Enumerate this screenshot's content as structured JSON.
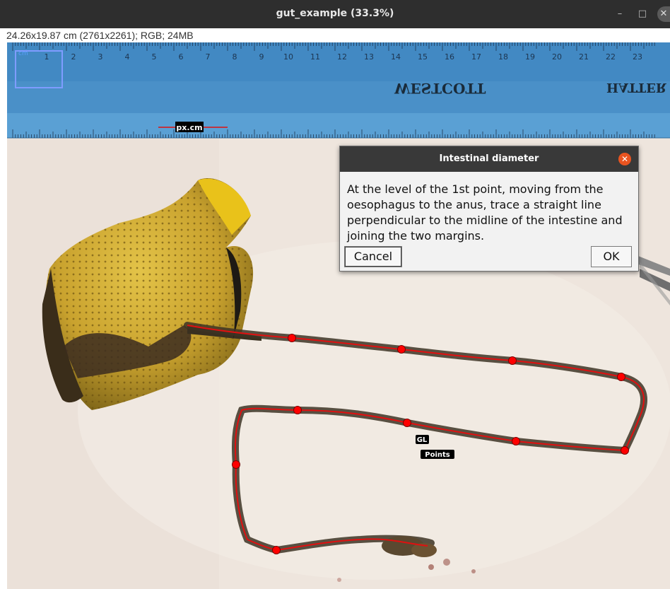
{
  "window": {
    "title": "gut_example (33.3%)",
    "minimize_glyph": "–",
    "maximize_glyph": "□",
    "close_glyph": "✕"
  },
  "image_info": "24.26x19.87 cm (2761x2261); RGB; 24MB",
  "overlay": {
    "scale_label": "px.cm",
    "gl_label": "GL",
    "points_label": "Points",
    "ruler_brand": "WESTCOTT",
    "ruler_numbers": [
      "1",
      "2",
      "3",
      "4",
      "5",
      "6",
      "7",
      "8",
      "9",
      "10",
      "11",
      "12",
      "13",
      "14",
      "15",
      "16",
      "17",
      "18",
      "19",
      "20",
      "21",
      "22",
      "23"
    ],
    "point_color": "#ff0000",
    "trace_color": "#e01010"
  },
  "dialog": {
    "title": "Intestinal diameter",
    "message": "At the level of the 1st point, moving from the oesophagus to the anus, trace a straight line perpendicular to the midline of the intestine and joining the two margins.",
    "cancel_label": "Cancel",
    "ok_label": "OK",
    "close_icon": "close-icon"
  }
}
